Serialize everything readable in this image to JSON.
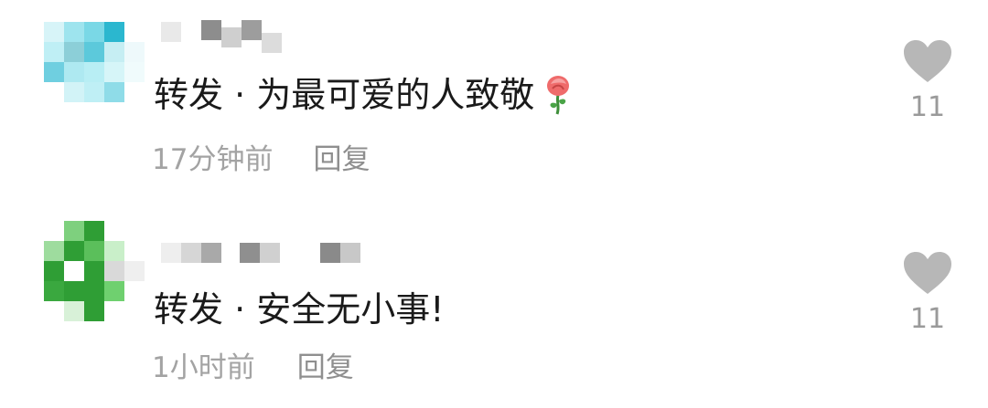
{
  "comments": [
    {
      "text": "转发 · 为最可爱的人致敬",
      "has_rose_emoji": true,
      "time": "17分钟前",
      "reply_label": "回复",
      "likes": "11",
      "avatar_colors": [
        "#2bb7cf",
        "#7ad8e6",
        "#bfeff5"
      ]
    },
    {
      "text": "转发 · 安全无小事!",
      "has_rose_emoji": false,
      "time": "1小时前",
      "reply_label": "回复",
      "likes": "11",
      "avatar_colors": [
        "#2f9e35",
        "#6fd06f",
        "#d8d8d8"
      ]
    }
  ],
  "icons": {
    "like": "heart-icon",
    "emoji": "rose-icon"
  }
}
